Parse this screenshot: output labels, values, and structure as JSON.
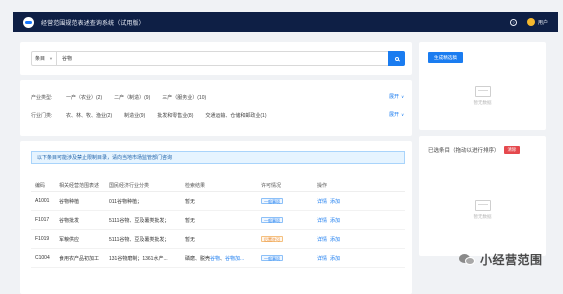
{
  "header": {
    "app_title": "经营范围规范表述查询系统（试用版）",
    "help_icon": "?",
    "user_label": "用户"
  },
  "search": {
    "type_selected": "条目",
    "query": "谷物",
    "button_icon": "search-icon"
  },
  "filters": {
    "industry_type": {
      "label": "产业类型:",
      "options": [
        "一产（农业）(2)",
        "二产（制造）(9)",
        "三产（服务业）(10)"
      ],
      "expand_label": "展开"
    },
    "industry_category": {
      "label": "行业门类:",
      "options": [
        "农、林、牧、渔业(2)",
        "制造业(9)",
        "批发和零售业(8)",
        "交通运输、仓储和邮政业(1)"
      ],
      "expand_label": "展开"
    }
  },
  "notice": "以下条目可能涉及禁止限制目录，请向当地市场监管部门咨询",
  "table": {
    "headers": [
      "编码",
      "相关经营范围表述",
      "国民经济行业分类",
      "检索结果",
      "许可情况",
      "操作"
    ],
    "rows": [
      {
        "code": "A1001",
        "name": "谷物种植",
        "category": "011谷物种植；",
        "result": "暂无",
        "permit": "一般事项",
        "permit_type": "general",
        "actions": [
          "详情",
          "添加"
        ]
      },
      {
        "code": "F1017",
        "name": "谷物批发",
        "category": "5111谷物、豆及薯类批发；",
        "result": "暂无",
        "permit": "一般事项",
        "permit_type": "general",
        "actions": [
          "详情",
          "添加"
        ]
      },
      {
        "code": "F1019",
        "name": "军粮供应",
        "category": "5111谷物、豆及薯类批发；",
        "result": "暂无",
        "permit": "后置许可",
        "permit_type": "post",
        "actions": [
          "详情",
          "添加"
        ]
      },
      {
        "code": "C1004",
        "name": "食用农产品初加工",
        "category": "131谷物磨制；1361水产...",
        "result_parts": [
          "磷磨、脱壳",
          "谷物",
          "、",
          "谷物加..."
        ],
        "permit": "一般事项",
        "permit_type": "general",
        "actions": [
          "详情",
          "添加"
        ]
      }
    ]
  },
  "sidebar": {
    "generate_button": "生成精选稿",
    "empty_text_1": "暂无数据",
    "selected_title": "已选条目（拖动以进行排序）",
    "clear_button": "清除",
    "empty_text_2": "暂无数据"
  },
  "watermark": "小经营范围",
  "colors": {
    "topbar": "#0e1f45",
    "primary": "#1a7cf0",
    "danger": "#e5484d",
    "post_permit": "#e67e22"
  }
}
